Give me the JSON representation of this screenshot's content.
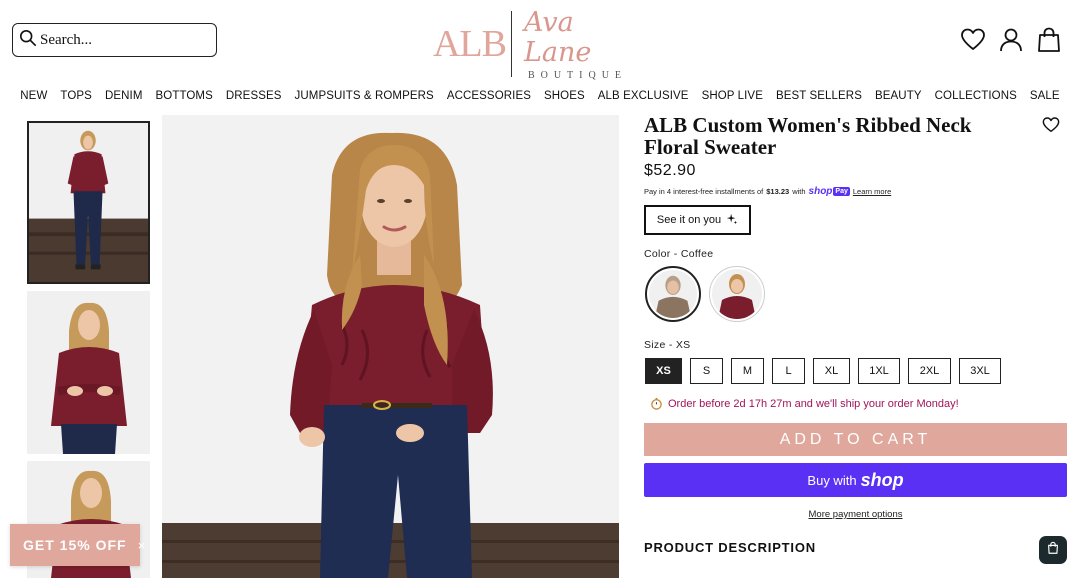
{
  "header": {
    "search_placeholder": "Search...",
    "logo": {
      "mark": "ALB",
      "script": "Ava Lane",
      "subtitle": "BOUTIQUE"
    },
    "icons": [
      "wishlist-heart-icon",
      "account-icon",
      "cart-bag-icon"
    ]
  },
  "nav": {
    "items": [
      "NEW",
      "TOPS",
      "DENIM",
      "BOTTOMS",
      "DRESSES",
      "JUMPSUITS & ROMPERS",
      "ACCESSORIES",
      "SHOES",
      "ALB EXCLUSIVE",
      "SHOP LIVE",
      "BEST SELLERS",
      "BEAUTY",
      "COLLECTIONS",
      "SALE"
    ]
  },
  "product": {
    "title": "ALB Custom Women's Ribbed Neck Floral Sweater",
    "price": "$52.90",
    "installments": {
      "prefix": "Pay in 4 interest-free installments of",
      "amount": "$13.23",
      "with": "with",
      "brand": "shop",
      "brand_badge": "Pay",
      "learn_more": "Learn more"
    },
    "see_it_label": "See it on you",
    "color_label": "Color - Coffee",
    "size_label": "Size - XS",
    "sizes": [
      "XS",
      "S",
      "M",
      "L",
      "XL",
      "1XL",
      "2XL",
      "3XL"
    ],
    "selected_size": "XS",
    "order_notice": "Order before 2d 17h 27m and we'll ship your order Monday!",
    "add_to_cart": "ADD TO CART",
    "buy_with": "Buy with",
    "buy_brand": "shop",
    "more_payment": "More payment options",
    "description_heading": "PRODUCT DESCRIPTION"
  },
  "promo": {
    "label": "GET 15% OFF",
    "close": "×"
  },
  "colors": {
    "accent_pink": "#e0a79c",
    "shop_purple": "#5a31f4",
    "notice_magenta": "#a0145c",
    "sweater": "#7a1d2c"
  }
}
